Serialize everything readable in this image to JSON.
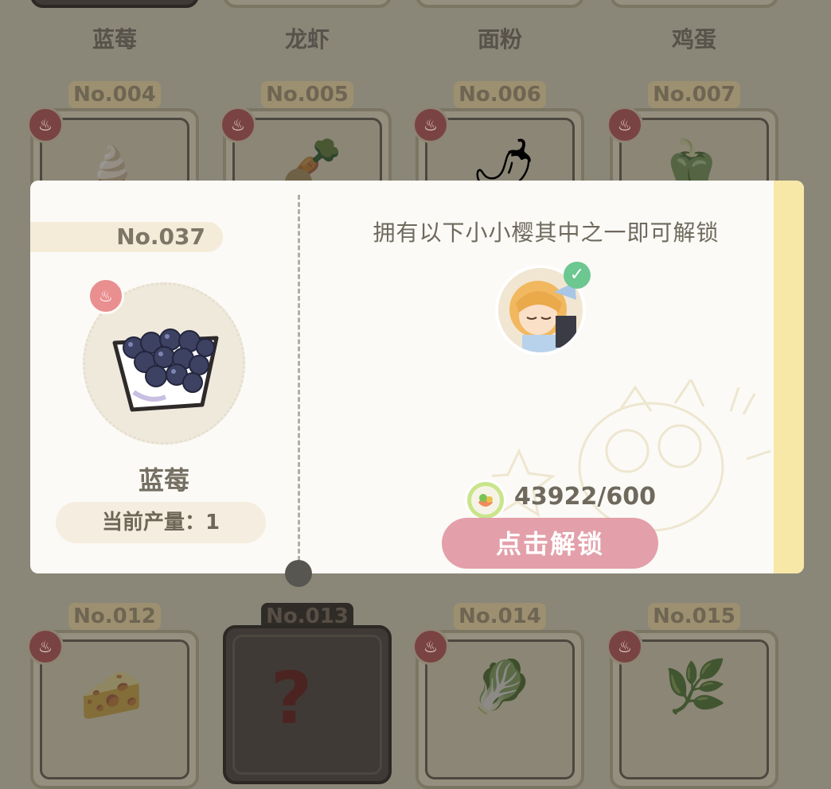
{
  "background_grid": {
    "row_top_labels": [
      "蓝莓",
      "龙虾",
      "面粉",
      "鸡蛋"
    ],
    "row_2": [
      {
        "no": "No.004"
      },
      {
        "no": "No.005"
      },
      {
        "no": "No.006"
      },
      {
        "no": "No.007"
      }
    ],
    "row_3": [
      {
        "no": "No.012"
      },
      {
        "no": "No.013",
        "locked": true
      },
      {
        "no": "No.014"
      },
      {
        "no": "No.015"
      }
    ]
  },
  "modal": {
    "item_number": "No.037",
    "item_name": "蓝莓",
    "yield_text": "当前产量：1",
    "unlock_title": "拥有以下小小樱其中之一即可解锁",
    "cost_text": "43922/600",
    "unlock_button_label": "点击解锁"
  },
  "colors": {
    "unlock_button": "#e3a0aa",
    "chef_badge": "#e98f8f",
    "check_badge": "#6cc790",
    "side_stripe": "#f7e8a7"
  },
  "icons": {
    "chef_badge": "chef-hat-icon",
    "owned": "check-icon",
    "currency": "food-coin-icon"
  }
}
